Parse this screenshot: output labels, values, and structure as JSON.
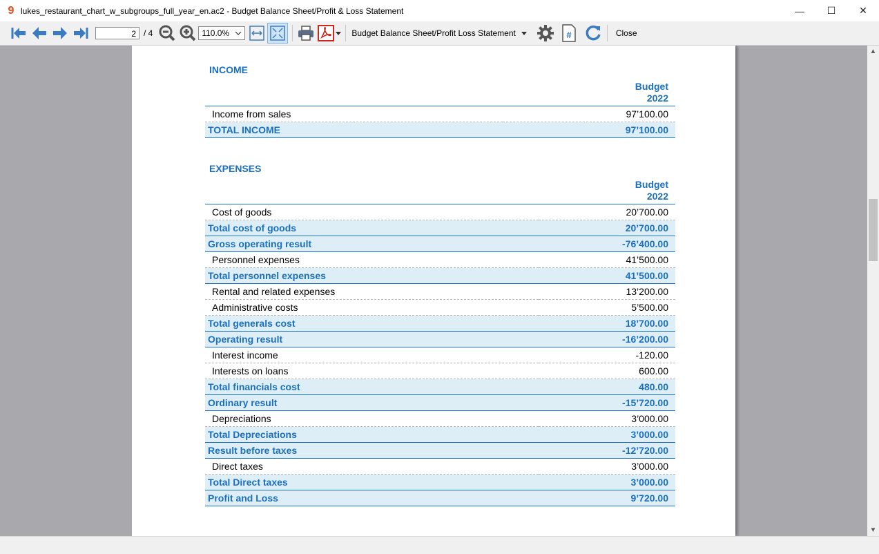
{
  "window": {
    "title": "lukes_restaurant_chart_w_subgroups_full_year_en.ac2 - Budget Balance Sheet/Profit & Loss Statement",
    "app_icon": "9",
    "minimize": "—",
    "maximize": "☐",
    "close": "✕"
  },
  "toolbar": {
    "page_current": "2",
    "page_total": "/ 4",
    "zoom": "110.0%",
    "report_name": "Budget Balance Sheet/Profit  Loss Statement",
    "close_label": "Close",
    "icons": [
      "first-page-icon",
      "prev-page-icon",
      "next-page-icon",
      "last-page-icon",
      "zoom-out-icon",
      "zoom-in-icon",
      "fit-width-icon",
      "fit-page-icon",
      "print-icon",
      "pdf-icon",
      "settings-icon",
      "page-number-icon",
      "refresh-icon"
    ],
    "accent": "#3b7bc4"
  },
  "report": {
    "accent": "#1a6fc0",
    "total_bg": "#deeef6",
    "income": {
      "title": "INCOME",
      "header_l1": "Budget",
      "header_l2": "2022",
      "rows": [
        {
          "label": "Income from sales",
          "amount": "97’100.00",
          "total": false
        },
        {
          "label": "TOTAL INCOME",
          "amount": "97’100.00",
          "total": true
        }
      ]
    },
    "expenses": {
      "title": "EXPENSES",
      "header_l1": "Budget",
      "header_l2": "2022",
      "rows": [
        {
          "label": "Cost of goods",
          "amount": "20’700.00",
          "total": false
        },
        {
          "label": "Total cost of goods",
          "amount": "20’700.00",
          "total": true
        },
        {
          "label": "Gross operating result",
          "amount": "-76’400.00",
          "total": true
        },
        {
          "label": "Personnel expenses",
          "amount": "41’500.00",
          "total": false
        },
        {
          "label": "Total personnel expenses",
          "amount": "41’500.00",
          "total": true
        },
        {
          "label": "Rental and related expenses",
          "amount": "13’200.00",
          "total": false
        },
        {
          "label": "Administrative costs",
          "amount": "5’500.00",
          "total": false
        },
        {
          "label": "Total generals cost",
          "amount": "18’700.00",
          "total": true
        },
        {
          "label": "Operating result",
          "amount": "-16’200.00",
          "total": true
        },
        {
          "label": "Interest income",
          "amount": "-120.00",
          "total": false
        },
        {
          "label": "Interests on loans",
          "amount": "600.00",
          "total": false
        },
        {
          "label": "Total financials cost",
          "amount": "480.00",
          "total": true
        },
        {
          "label": "Ordinary result",
          "amount": "-15’720.00",
          "total": true
        },
        {
          "label": "Depreciations",
          "amount": "3’000.00",
          "total": false
        },
        {
          "label": "Total Depreciations",
          "amount": "3’000.00",
          "total": true
        },
        {
          "label": "Result before taxes",
          "amount": "-12’720.00",
          "total": true
        },
        {
          "label": "Direct taxes",
          "amount": "3’000.00",
          "total": false
        },
        {
          "label": "Total Direct taxes",
          "amount": "3’000.00",
          "total": true
        },
        {
          "label": "Profit and Loss",
          "amount": "9’720.00",
          "total": true
        }
      ]
    }
  }
}
